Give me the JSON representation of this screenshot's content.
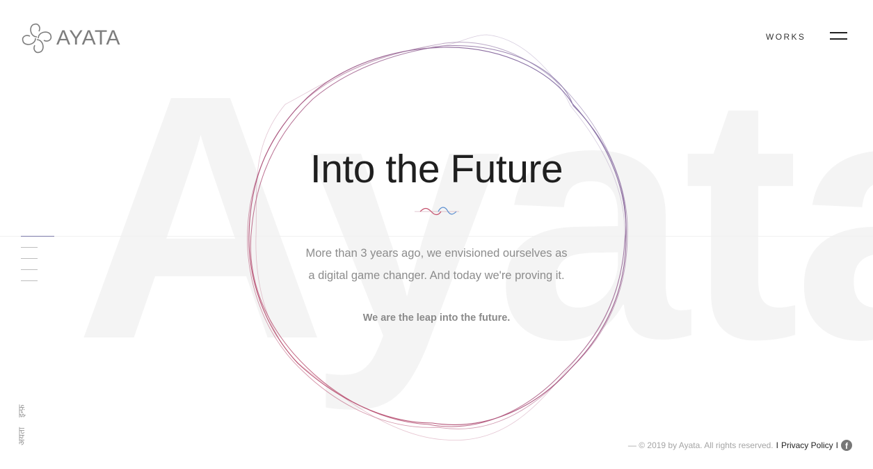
{
  "brand": {
    "name": "AYATA",
    "logo_icon": "clover-logo-icon"
  },
  "nav": {
    "works_label": "WORKS",
    "menu_icon": "hamburger-menu-icon"
  },
  "background_word": "Ayata",
  "hero": {
    "title": "Into the Future",
    "line1": "More than 3 years ago, we envisioned ourselves as",
    "line2": "a digital game changer. And today we're proving it.",
    "tagline": "We are the leap into the future."
  },
  "side": {
    "vertical_text_1": "अयता",
    "vertical_text_2": "इन्फ़"
  },
  "slides": {
    "count": 5,
    "active_index": 0
  },
  "footer": {
    "copyright": "— © 2019 by Ayata. All rights reserved.",
    "separator": "I",
    "privacy_label": "Privacy Policy",
    "social_icon": "facebook-icon"
  },
  "colors": {
    "ring_red": "#c4506c",
    "ring_blue": "#7a7cb4",
    "text_dark": "#1f1f1f",
    "text_gray": "#8c8c8c",
    "bg_word": "#f4f4f4"
  }
}
